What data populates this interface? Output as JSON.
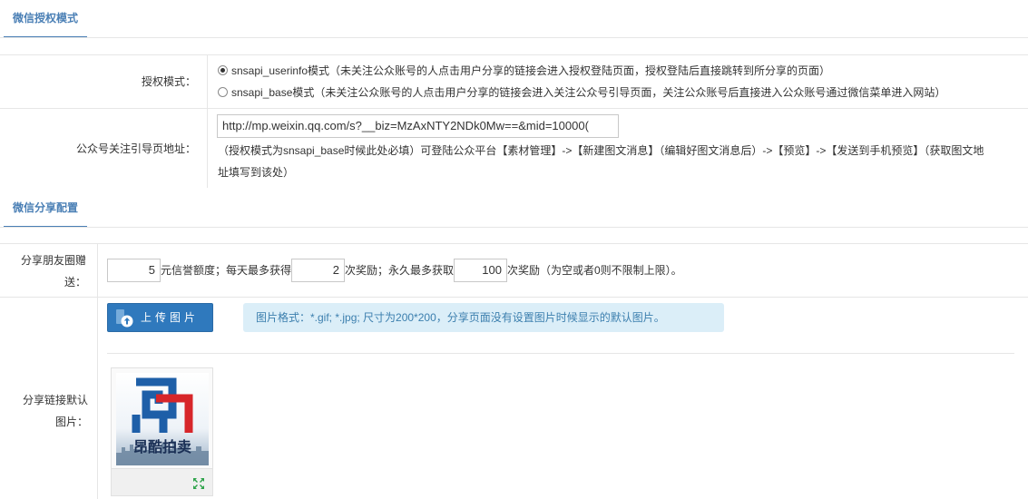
{
  "sections": {
    "auth": {
      "title": "微信授权模式"
    },
    "share": {
      "title": "微信分享配置"
    }
  },
  "auth_mode": {
    "label": "授权模式：",
    "options": [
      {
        "text": "snsapi_userinfo模式（未关注公众账号的人点击用户分享的链接会进入授权登陆页面，授权登陆后直接跳转到所分享的页面）",
        "checked": true
      },
      {
        "text": "snsapi_base模式（未关注公众账号的人点击用户分享的链接会进入关注公众号引导页面，关注公众账号后直接进入公众账号通过微信菜单进入网站）",
        "checked": false
      }
    ]
  },
  "guide_url": {
    "label": "公众号关注引导页地址：",
    "value": "http://mp.weixin.qq.com/s?__biz=MzAxNTY2NDk0Mw==&mid=10000(",
    "help_line1": "（授权模式为snsapi_base时候此处必填）可登陆公众平台【素材管理】->【新建图文消息】（编辑好图文消息后）->【预览】->【发送到手机预览】（获取图文地",
    "help_line2": "址填写到该处）"
  },
  "moments_reward": {
    "label_line1": "分享朋友圈赠",
    "label_line2": "送：",
    "credit_value": "5",
    "credit_suffix": "元信誉额度；每天最多获得",
    "daily_value": "2",
    "daily_suffix": "次奖励；永久最多获取",
    "total_value": "100",
    "total_suffix": "次奖励（为空或者0则不限制上限）。"
  },
  "default_image": {
    "label_line1": "分享链接默认",
    "label_line2": "图片：",
    "upload_label": "上传图片",
    "tip": "图片格式：*.gif; *.jpg; 尺寸为200*200，分享页面没有设置图片时候显示的默认图片。",
    "logo_text": "昂酷拍卖"
  },
  "icons": {
    "upload": "upload-icon",
    "expand": "expand-icon"
  },
  "colors": {
    "accent": "#4a7fb5",
    "button": "#2f79bd",
    "tip_bg": "#dbeef8",
    "tip_text": "#3c7fae",
    "logo_blue": "#1e5fa8",
    "logo_red": "#d7262a"
  }
}
